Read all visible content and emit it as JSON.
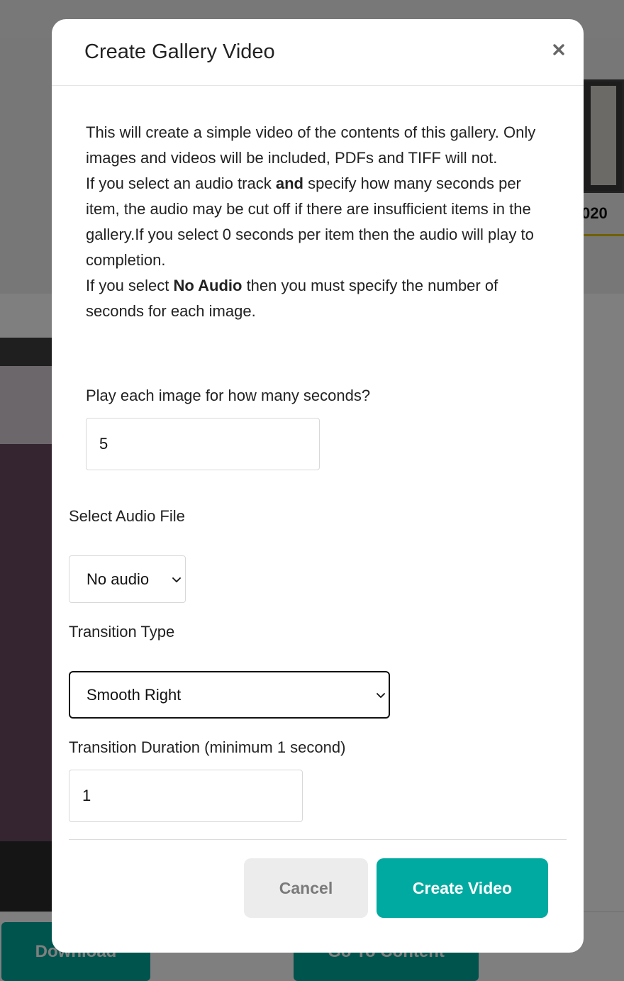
{
  "background": {
    "thumb_label": "020",
    "download_label": "Download",
    "goto_label": "Go To Content"
  },
  "modal": {
    "title": "Create Gallery Video",
    "close_icon": "close-icon",
    "description": {
      "line1": "This will create a simple video of the contents of this gallery. Only images and videos will be included, PDFs and TIFF will not.",
      "line2_pre": "If you select an audio track ",
      "line2_bold": "and",
      "line2_post": " specify how many seconds per item, the audio may be cut off if there are insufficient items in the gallery.If you select 0 seconds per item then the audio will play to completion.",
      "line3_pre": "If you select ",
      "line3_bold": "No Audio",
      "line3_post": " then you must specify the number of seconds for each image."
    },
    "seconds_label": "Play each image for how many seconds?",
    "seconds_value": "5",
    "audio_label": "Select Audio File",
    "audio_selected": "No audio",
    "transition_label": "Transition Type",
    "transition_selected": "Smooth Right",
    "duration_label": "Transition Duration (minimum 1 second)",
    "duration_value": "1",
    "cancel_label": "Cancel",
    "create_label": "Create Video"
  },
  "colors": {
    "accent": "#00aaa0",
    "cancel_bg": "#ececec",
    "overlay": "rgba(0,0,0,0.5)"
  }
}
